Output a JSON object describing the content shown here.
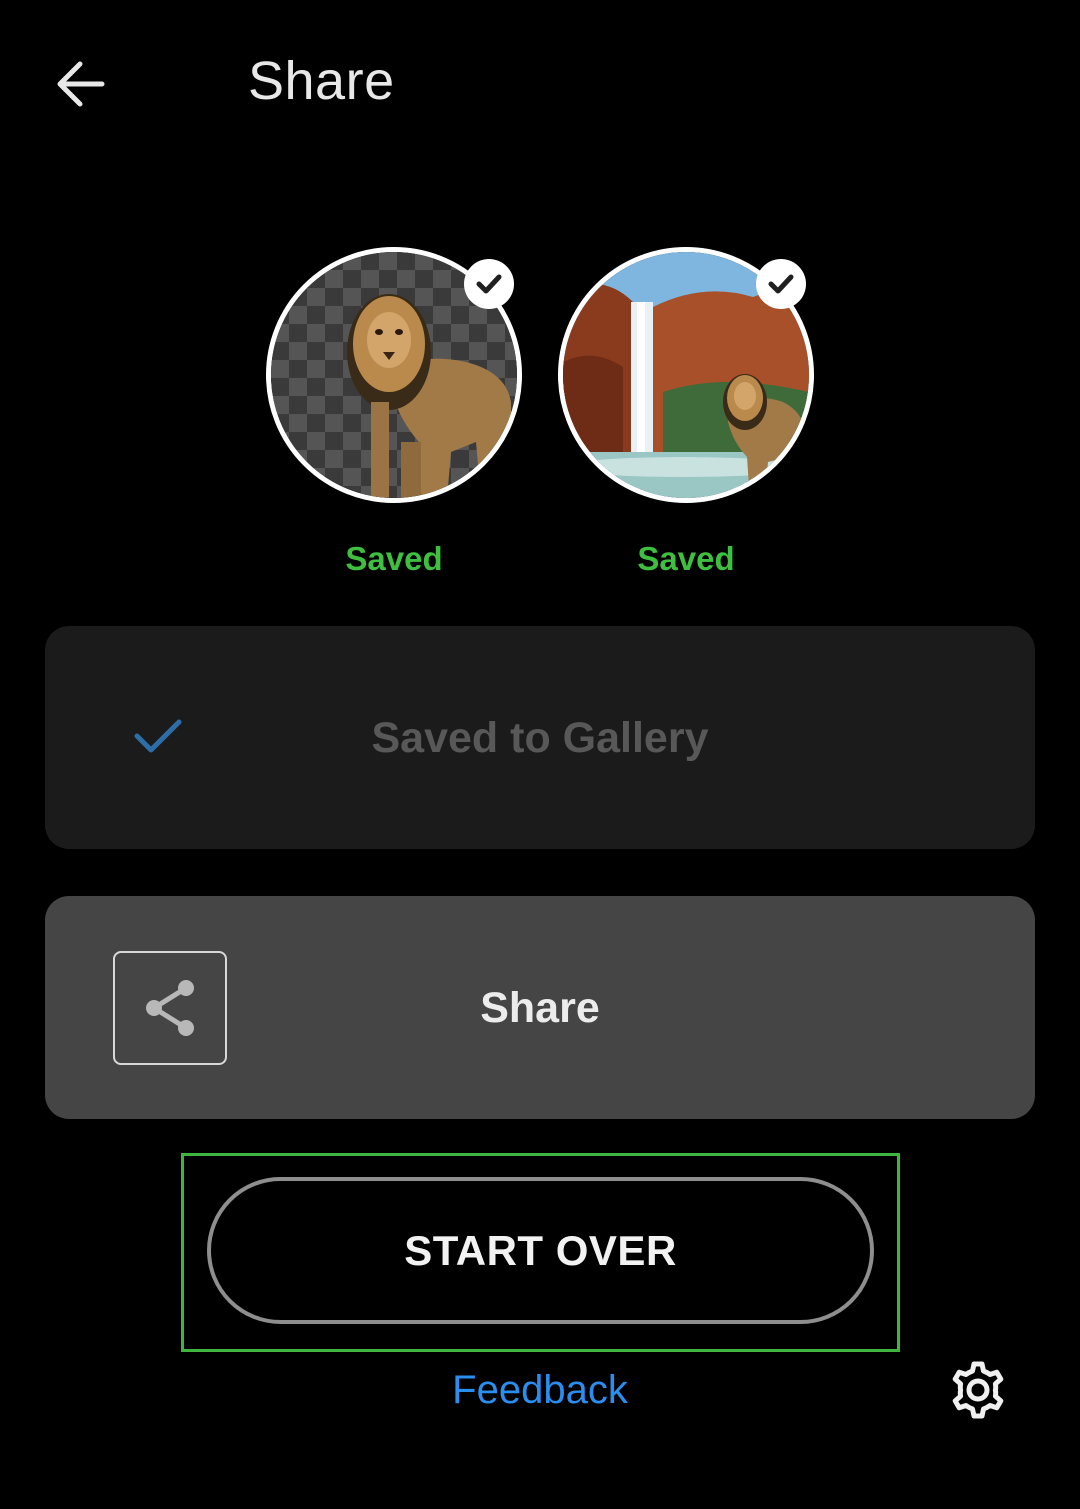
{
  "header": {
    "title": "Share",
    "back_icon": "arrow-left-icon"
  },
  "thumbnails": [
    {
      "name": "cutout-result",
      "label": "Saved",
      "badge_icon": "check-icon",
      "description_icon": "lion-transparent-background"
    },
    {
      "name": "composite-result",
      "label": "Saved",
      "badge_icon": "check-icon",
      "description_icon": "lion-waterfall-background"
    }
  ],
  "gallery_card": {
    "label": "Saved to Gallery",
    "icon": "check-icon"
  },
  "share_card": {
    "label": "Share",
    "icon": "share-icon"
  },
  "start_over": {
    "label": "START OVER"
  },
  "feedback": {
    "label": "Feedback"
  },
  "settings": {
    "icon": "gear-icon"
  },
  "colors": {
    "background": "#000000",
    "saved_green": "#3fbf3f",
    "highlight_green": "#3fb43f",
    "feedback_blue": "#2a8ef0",
    "gallery_card": "#1b1b1b",
    "share_card": "#454545",
    "check_blue": "#2d6ea8"
  }
}
